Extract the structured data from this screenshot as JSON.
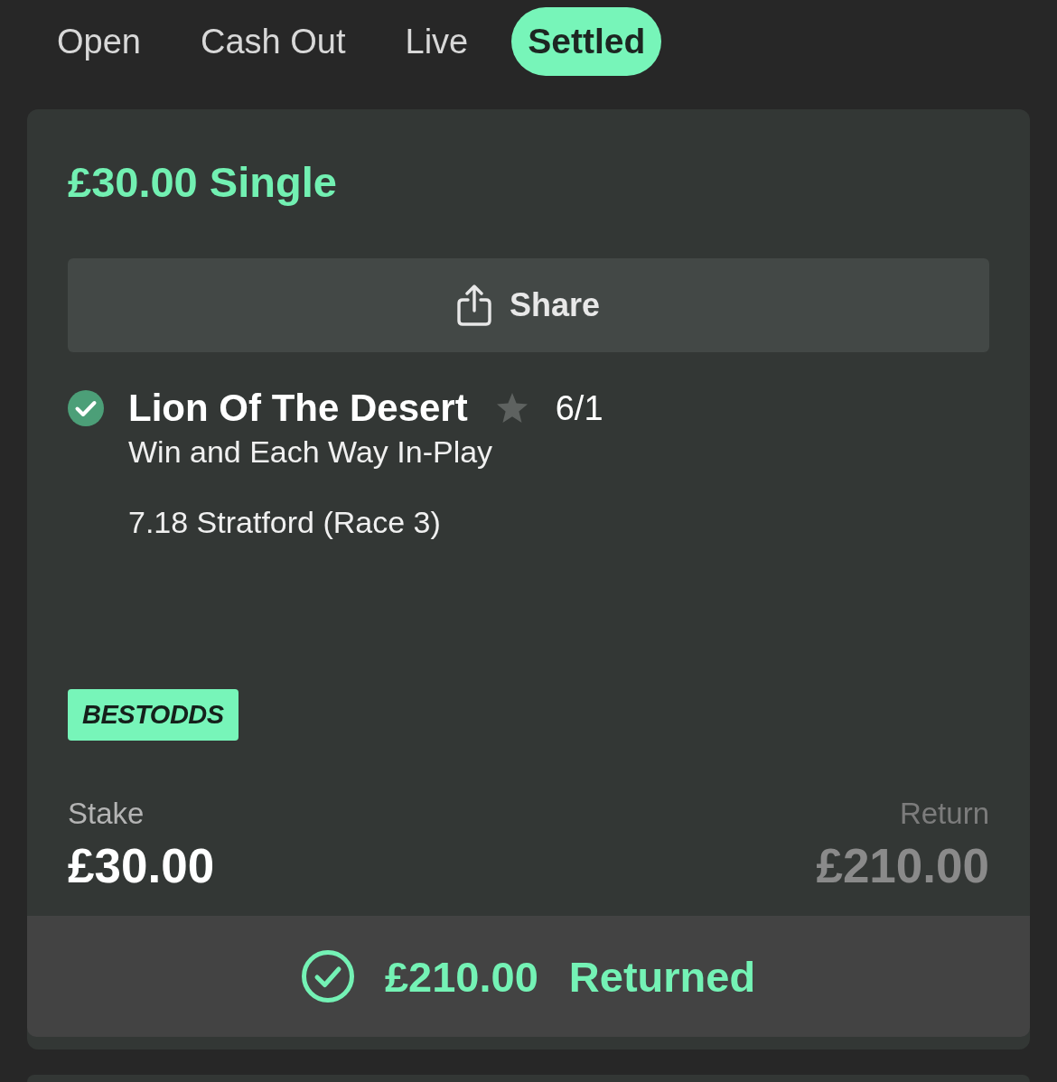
{
  "tabs": [
    {
      "label": "Open",
      "selected": false
    },
    {
      "label": "Cash Out",
      "selected": false
    },
    {
      "label": "Live",
      "selected": false
    },
    {
      "label": "Settled",
      "selected": true
    }
  ],
  "bet": {
    "title": "£30.00 Single",
    "share_button": "Share",
    "selections": [
      {
        "name": "Lion Of The Desert",
        "odds": "6/1",
        "market": "Win and Each Way In-Play",
        "event": "7.18 Stratford (Race 3)",
        "won": true
      }
    ],
    "badge": "BESTODDS",
    "stake": {
      "label": "Stake",
      "value": "£30.00"
    },
    "return": {
      "label": "Return",
      "value": "£210.00"
    },
    "settlement": {
      "returned": true,
      "amount": "£210.00",
      "label": "Returned"
    }
  }
}
